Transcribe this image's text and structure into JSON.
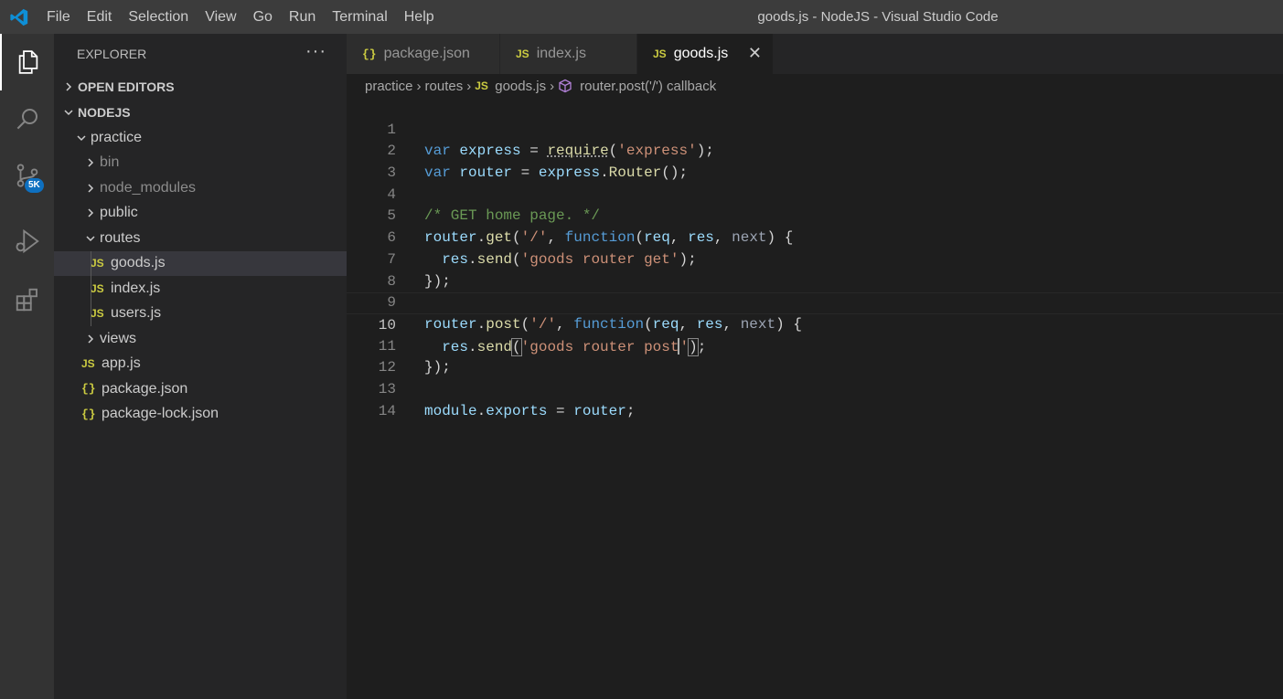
{
  "titlebar": {
    "logo_icon": "vscode-logo-icon",
    "menu": [
      "File",
      "Edit",
      "Selection",
      "View",
      "Go",
      "Run",
      "Terminal",
      "Help"
    ],
    "window_title": "goods.js - NodeJS - Visual Studio Code"
  },
  "activitybar": {
    "items": [
      {
        "name": "explorer-icon"
      },
      {
        "name": "search-icon"
      },
      {
        "name": "source-control-icon",
        "badge": "5K"
      },
      {
        "name": "run-debug-icon"
      },
      {
        "name": "extensions-icon"
      }
    ]
  },
  "sidebar": {
    "title": "EXPLORER",
    "more_label": "···",
    "open_editors": "OPEN EDITORS",
    "root": "NODEJS",
    "tree": [
      {
        "label": "practice",
        "type": "folder",
        "open": true,
        "depth": 1
      },
      {
        "label": "bin",
        "type": "folder",
        "open": false,
        "depth": 2
      },
      {
        "label": "node_modules",
        "type": "folder",
        "open": false,
        "depth": 2
      },
      {
        "label": "public",
        "type": "folder",
        "open": false,
        "depth": 2
      },
      {
        "label": "routes",
        "type": "folder",
        "open": true,
        "depth": 2
      },
      {
        "label": "goods.js",
        "type": "js",
        "depth": 3,
        "selected": true
      },
      {
        "label": "index.js",
        "type": "js",
        "depth": 3
      },
      {
        "label": "users.js",
        "type": "js",
        "depth": 3
      },
      {
        "label": "views",
        "type": "folder",
        "open": false,
        "depth": 2
      },
      {
        "label": "app.js",
        "type": "js",
        "depth": 2
      },
      {
        "label": "package.json",
        "type": "json",
        "depth": 2
      },
      {
        "label": "package-lock.json",
        "type": "json",
        "depth": 2
      }
    ],
    "js_icon_text": "JS",
    "json_icon_text": "{}"
  },
  "tabs": [
    {
      "label": "package.json",
      "icon": "{}",
      "active": false
    },
    {
      "label": "index.js",
      "icon": "JS",
      "active": false
    },
    {
      "label": "goods.js",
      "icon": "JS",
      "active": true
    }
  ],
  "breadcrumbs": {
    "parts": [
      "practice",
      "routes",
      "goods.js",
      "router.post('/') callback"
    ],
    "js_icon_text": "JS"
  },
  "editor": {
    "line_numbers": [
      "1",
      "2",
      "3",
      "4",
      "5",
      "6",
      "7",
      "8",
      "9",
      "10",
      "11",
      "12",
      "13",
      "14"
    ],
    "current_line": 10
  },
  "colors": {
    "keyword": "#569cd6",
    "variable": "#9cdcfe",
    "function": "#dcdcaa",
    "string": "#ce9178",
    "comment": "#6a9955",
    "badge": "#0e70c0"
  }
}
